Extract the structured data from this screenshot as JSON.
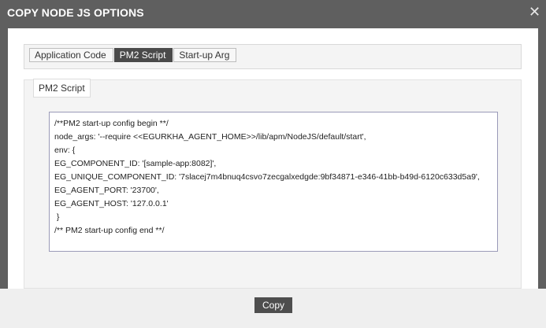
{
  "dialog": {
    "title": "COPY NODE JS OPTIONS",
    "close_icon": "close-icon",
    "close_glyph": "✕"
  },
  "tabs": [
    {
      "label": "Application Code",
      "active": false
    },
    {
      "label": "PM2 Script",
      "active": true
    },
    {
      "label": "Start-up Arg",
      "active": false
    }
  ],
  "section": {
    "legend": "PM2 Script",
    "lines": [
      "/**PM2 start-up config begin **/",
      "node_args: '--require <<EGURKHA_AGENT_HOME>>/lib/apm/NodeJS/default/start',",
      "env: {",
      "EG_COMPONENT_ID: '[sample-app:8082]',",
      "EG_UNIQUE_COMPONENT_ID: '7slacej7m4bnuq4csvo7zecgalxedgde:9bf34871-e346-41bb-b49d-6120c633d5a9',",
      "EG_AGENT_PORT: '23700',",
      "EG_AGENT_HOST: '127.0.0.1'",
      " }",
      "/** PM2 start-up config end **/"
    ]
  },
  "footer": {
    "copy_label": "Copy"
  },
  "colors": {
    "titlebar_bg": "#5f5f5f",
    "active_tab_bg": "#4a4a4a",
    "button_bg": "#4e4e4e"
  }
}
